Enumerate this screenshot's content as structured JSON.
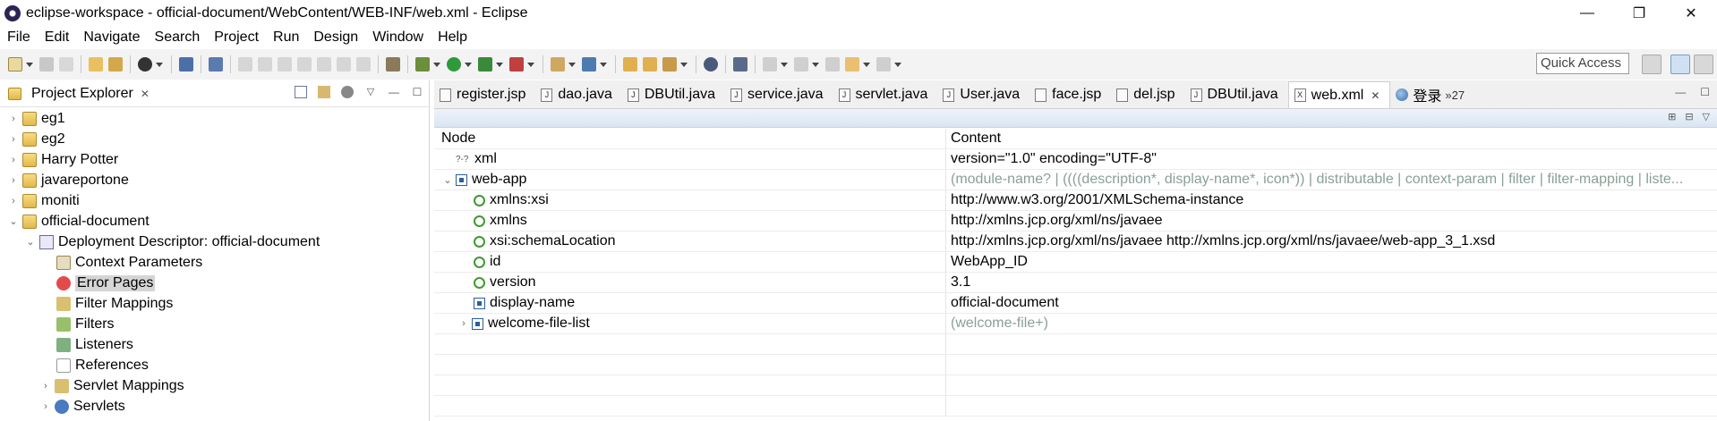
{
  "window": {
    "title": "eclipse-workspace - official-document/WebContent/WEB-INF/web.xml - Eclipse",
    "controls": {
      "minimize": "—",
      "restore": "❐",
      "close": "✕"
    }
  },
  "menu": [
    "File",
    "Edit",
    "Navigate",
    "Search",
    "Project",
    "Run",
    "Design",
    "Window",
    "Help"
  ],
  "toolbar": {
    "quick_access": "Quick Access"
  },
  "project_explorer": {
    "title": "Project Explorer",
    "close": "✕",
    "items": [
      {
        "label": "eg1",
        "expanded": false,
        "level": 0
      },
      {
        "label": "eg2",
        "expanded": false,
        "level": 0
      },
      {
        "label": "Harry Potter",
        "expanded": false,
        "level": 0
      },
      {
        "label": "javareportone",
        "expanded": false,
        "level": 0
      },
      {
        "label": "moniti",
        "expanded": false,
        "level": 0
      },
      {
        "label": "official-document",
        "expanded": true,
        "level": 0
      },
      {
        "label": "Deployment Descriptor: official-document",
        "expanded": true,
        "level": 1
      },
      {
        "label": "Context Parameters",
        "level": 2
      },
      {
        "label": "Error Pages",
        "level": 2,
        "selected": true
      },
      {
        "label": "Filter Mappings",
        "level": 2
      },
      {
        "label": "Filters",
        "level": 2
      },
      {
        "label": "Listeners",
        "level": 2
      },
      {
        "label": "References",
        "level": 2
      },
      {
        "label": "Servlet Mappings",
        "level": 2,
        "expanded": false
      },
      {
        "label": "Servlets",
        "level": 2,
        "expanded": false
      }
    ]
  },
  "editor": {
    "tabs": [
      {
        "label": "register.jsp",
        "icon": "jsp"
      },
      {
        "label": "dao.java",
        "icon": "java"
      },
      {
        "label": "DBUtil.java",
        "icon": "java"
      },
      {
        "label": "service.java",
        "icon": "java"
      },
      {
        "label": "servlet.java",
        "icon": "java"
      },
      {
        "label": "User.java",
        "icon": "java"
      },
      {
        "label": "face.jsp",
        "icon": "jsp"
      },
      {
        "label": "del.jsp",
        "icon": "jsp"
      },
      {
        "label": "DBUtil.java",
        "icon": "java"
      },
      {
        "label": "web.xml",
        "icon": "xml",
        "active": true
      },
      {
        "label": "登录",
        "icon": "globe"
      }
    ],
    "overflow": "»27",
    "close": "✕",
    "columns": {
      "node": "Node",
      "content": "Content"
    },
    "rows": [
      {
        "node": "xml",
        "content": "version=\"1.0\" encoding=\"UTF-8\"",
        "kind": "pi",
        "level": 0
      },
      {
        "node": "web-app",
        "content": "(module-name? | ((((description*, display-name*, icon*)) | distributable | context-param | filter | filter-mapping | liste...",
        "kind": "element",
        "level": 0,
        "expanded": true,
        "gray": true
      },
      {
        "node": "xmlns:xsi",
        "content": "http://www.w3.org/2001/XMLSchema-instance",
        "kind": "attr",
        "level": 1
      },
      {
        "node": "xmlns",
        "content": "http://xmlns.jcp.org/xml/ns/javaee",
        "kind": "attr",
        "level": 1
      },
      {
        "node": "xsi:schemaLocation",
        "content": "http://xmlns.jcp.org/xml/ns/javaee http://xmlns.jcp.org/xml/ns/javaee/web-app_3_1.xsd",
        "kind": "attr",
        "level": 1
      },
      {
        "node": "id",
        "content": "WebApp_ID",
        "kind": "attr",
        "level": 1
      },
      {
        "node": "version",
        "content": "3.1",
        "kind": "attr",
        "level": 1
      },
      {
        "node": "display-name",
        "content": "official-document",
        "kind": "element",
        "level": 1
      },
      {
        "node": "welcome-file-list",
        "content": "(welcome-file+)",
        "kind": "element",
        "level": 1,
        "expanded": false,
        "gray": true
      }
    ]
  }
}
